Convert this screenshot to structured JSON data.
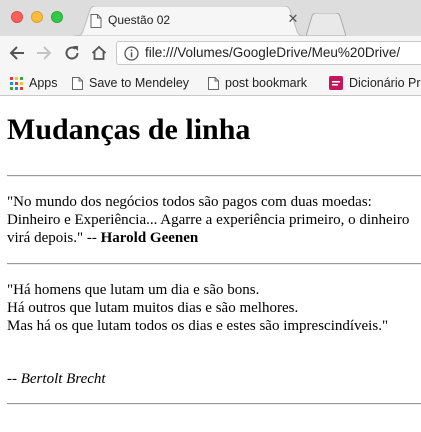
{
  "browser": {
    "tab": {
      "title": "Questão 02"
    },
    "address_bar": {
      "url": "file:///Volumes/GoogleDrive/Meu%20Drive/"
    },
    "bookmarks": [
      {
        "label": "Apps",
        "icon": "apps-grid-icon"
      },
      {
        "label": "Save to Mendeley",
        "icon": "page-icon"
      },
      {
        "label": "post bookmark",
        "icon": "page-icon"
      },
      {
        "label": "Dicionário Pr",
        "icon": "dicionario-favicon"
      }
    ]
  },
  "page": {
    "heading": "Mudanças de linha",
    "quote1": {
      "text": "\"No mundo dos negócios todos são pagos com duas moedas: Dinheiro e Experiência... Agarre a experiência primeiro, o dinheiro virá depois.\" --",
      "author": "Harold Geenen"
    },
    "quote2": {
      "lines": [
        "\"Há homens que lutam um dia e são bons.",
        "Há outros que lutam muitos dias e são melhores.",
        "Mas há os que lutam todos os dias e estes são imprescindíveis.\""
      ],
      "attribution": "-- Bertolt Brecht"
    }
  },
  "colors": {
    "tabstrip": "#dddddd",
    "toolbar": "#f6f6f6",
    "close_red": "#fc605c",
    "minimize_yellow": "#fdbc40",
    "zoom_green": "#34c84a",
    "dicionario_favicon": "#c2185b"
  }
}
